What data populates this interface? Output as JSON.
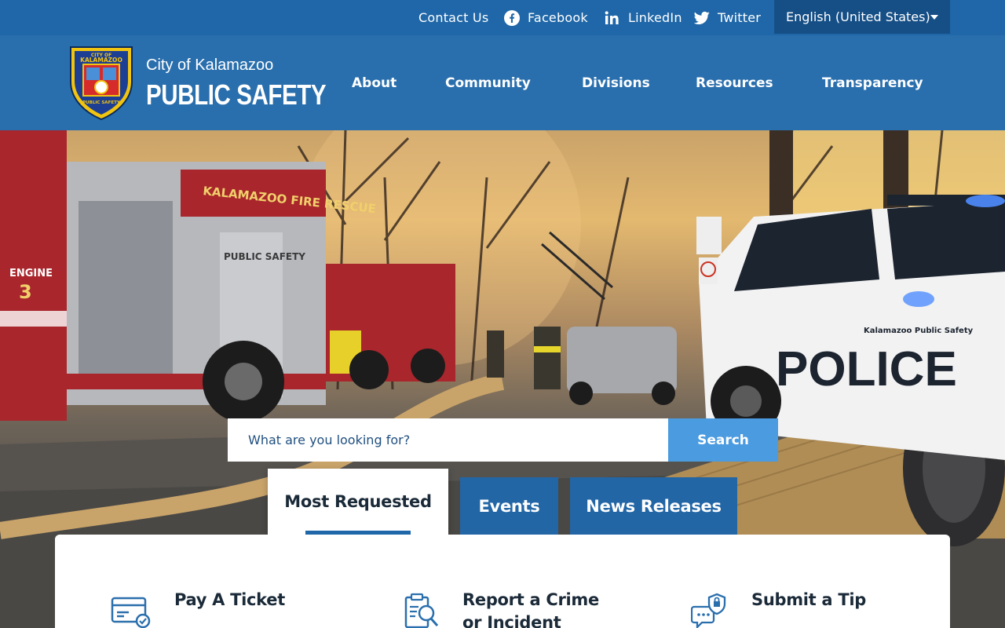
{
  "topbar": {
    "contact_us": "Contact Us",
    "facebook": "Facebook",
    "linkedin": "LinkedIn",
    "twitter": "Twitter",
    "language": "English (United States)",
    "icons": [
      "facebook-icon",
      "linkedin-icon",
      "twitter-icon",
      "chevron-down-icon"
    ]
  },
  "header": {
    "brand_line1": "City of Kalamazoo",
    "brand_line2": "PUBLIC SAFETY",
    "badge_text_top": "CITY OF",
    "badge_text_mid": "KALAMAZOO",
    "badge_text_bottom": "PUBLIC SAFETY"
  },
  "nav": {
    "items": [
      {
        "label": "About"
      },
      {
        "label": "Community"
      },
      {
        "label": "Divisions"
      },
      {
        "label": "Resources"
      },
      {
        "label": "Transparency"
      }
    ]
  },
  "search": {
    "placeholder": "What are you looking for?",
    "button_label": "Search"
  },
  "tabs": [
    {
      "label": "Most Requested",
      "active": true
    },
    {
      "label": "Events",
      "active": false
    },
    {
      "label": "News Releases",
      "active": false
    }
  ],
  "quick_links": [
    {
      "label": "Pay A Ticket",
      "icon": "credit-card-icon"
    },
    {
      "label": "Report a Crime or Incident",
      "icon": "clipboard-search-icon"
    },
    {
      "label": "Submit a Tip",
      "icon": "chat-lock-icon"
    }
  ],
  "hero_scene": {
    "fire_truck_text": "KALAMAZOO FIRE RESCUE",
    "truck_side_text": "PUBLIC SAFETY",
    "engine_text": "ENGINE",
    "engine_number": "3",
    "police_text": "POLICE",
    "police_sub_text": "Kalamazoo Public Safety"
  },
  "colors": {
    "topbar": "#1f67a8",
    "header": "#2a6fad",
    "language_bg": "#164f86",
    "search_button": "#4a9be0",
    "tab_inactive": "#2266a6",
    "text_dark": "#1b2a38"
  }
}
